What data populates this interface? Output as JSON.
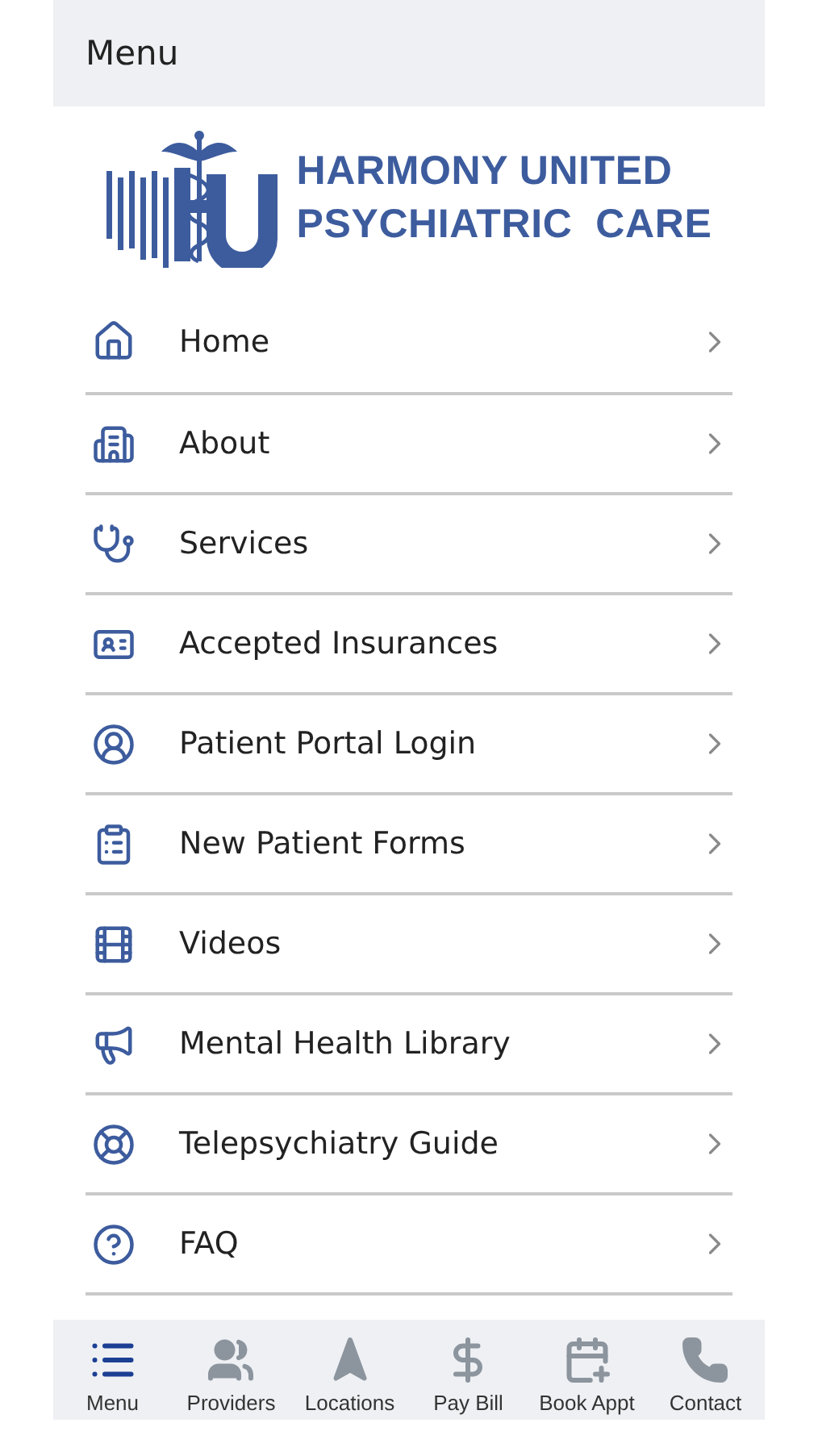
{
  "header": {
    "title": "Menu"
  },
  "logo": {
    "line_1": "HARMONY UNITED",
    "line_2": "PSYCHIATRIC  CARE"
  },
  "menu_items": [
    {
      "label": "Home"
    },
    {
      "label": "About"
    },
    {
      "label": "Services"
    },
    {
      "label": "Accepted Insurances"
    },
    {
      "label": "Patient Portal Login"
    },
    {
      "label": "New Patient Forms"
    },
    {
      "label": "Videos"
    },
    {
      "label": "Mental Health Library"
    },
    {
      "label": "Telepsychiatry Guide"
    },
    {
      "label": "FAQ"
    }
  ],
  "tab_bar": [
    {
      "label": "Menu",
      "selected": true
    },
    {
      "label": "Providers",
      "selected": false
    },
    {
      "label": "Locations",
      "selected": false
    },
    {
      "label": "Pay Bill",
      "selected": false
    },
    {
      "label": "Book Appt",
      "selected": false
    },
    {
      "label": "Contact",
      "selected": false
    }
  ]
}
